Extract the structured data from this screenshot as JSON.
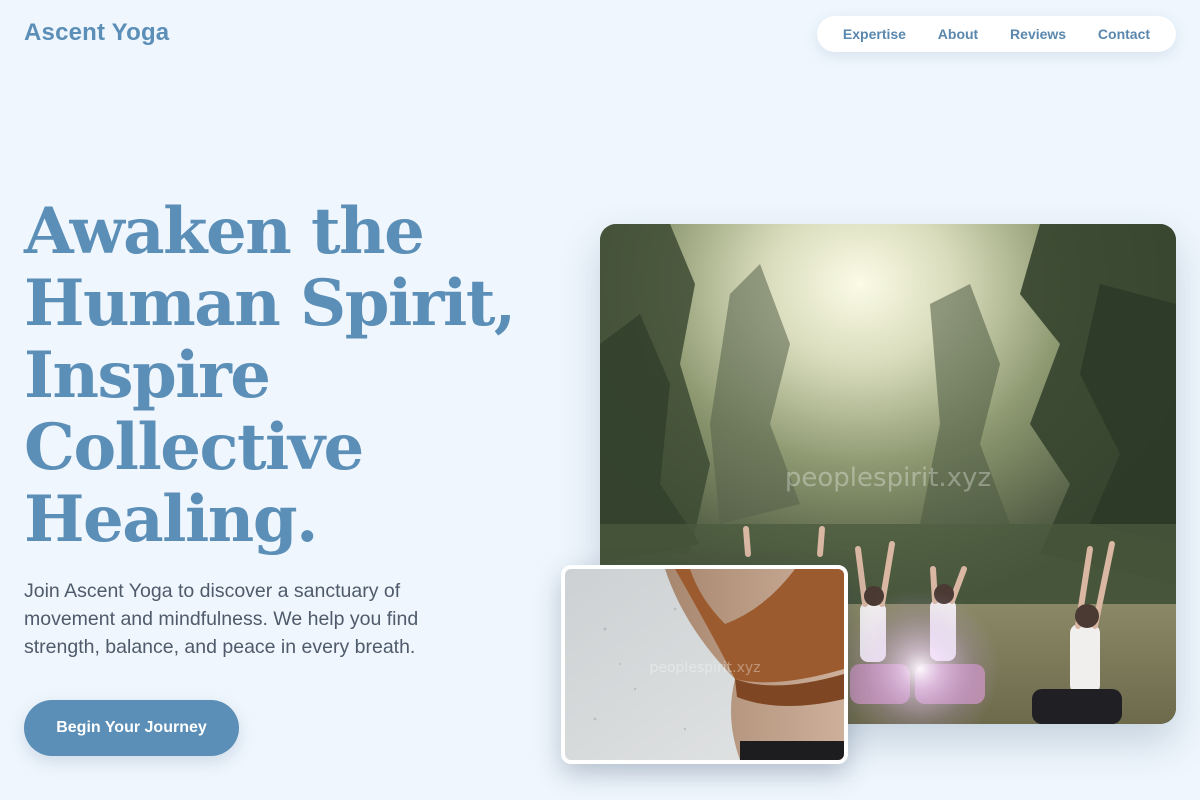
{
  "brand": {
    "name": "Ascent Yoga"
  },
  "nav": {
    "items": [
      {
        "label": "Expertise"
      },
      {
        "label": "About"
      },
      {
        "label": "Reviews"
      },
      {
        "label": "Contact"
      }
    ]
  },
  "hero": {
    "headline_lines": [
      "Awaken the",
      "Human Spirit,",
      "Inspire",
      "Collective",
      "Healing."
    ],
    "subtitle": "Join Ascent Yoga to discover a sanctuary of movement and mindfulness. We help you find strength, balance, and peace in every breath.",
    "cta_label": "Begin Your Journey"
  },
  "images": {
    "main_watermark": "peoplespirit.xyz",
    "small_watermark": "peoplespirit.xyz"
  },
  "colors": {
    "background": "#eff6fd",
    "accent": "#5b8fb7",
    "nav_background": "#ffffff",
    "text": "#4f5b6b"
  }
}
